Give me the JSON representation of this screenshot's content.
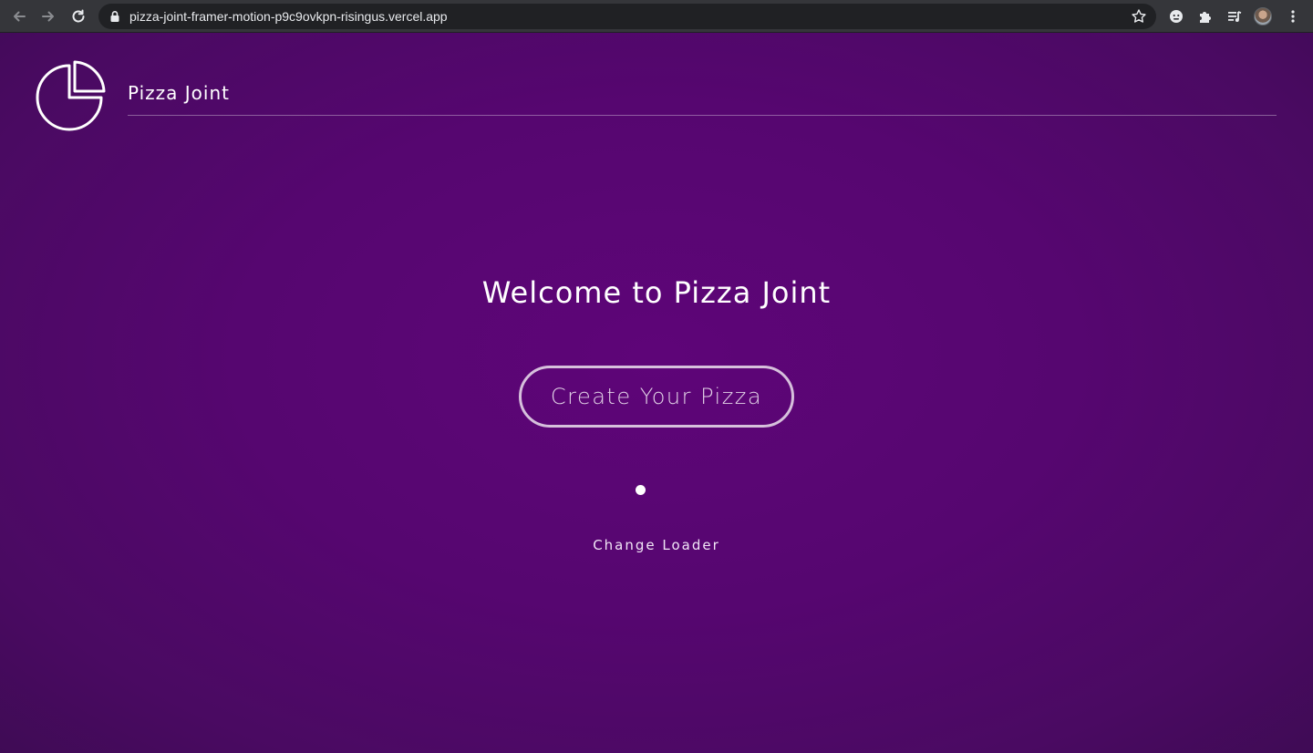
{
  "browser": {
    "url": "pizza-joint-framer-motion-p9c9ovkpn-risingus.vercel.app",
    "icons": [
      "back-icon",
      "forward-icon",
      "reload-icon",
      "lock-icon",
      "star-icon",
      "extension-icon",
      "puzzle-icon",
      "media-icon",
      "avatar",
      "menu-icon"
    ]
  },
  "header": {
    "brand": "Pizza Joint",
    "logo_icon": "pizza-slice-icon"
  },
  "main": {
    "heading": "Welcome to Pizza Joint",
    "cta_label": "Create Your Pizza",
    "loader_icon": "loader-dot",
    "change_loader_label": "Change Loader"
  },
  "colors": {
    "background": "#560670",
    "text": "#ffffff",
    "chrome": "#35363a",
    "omnibox": "#202124"
  }
}
